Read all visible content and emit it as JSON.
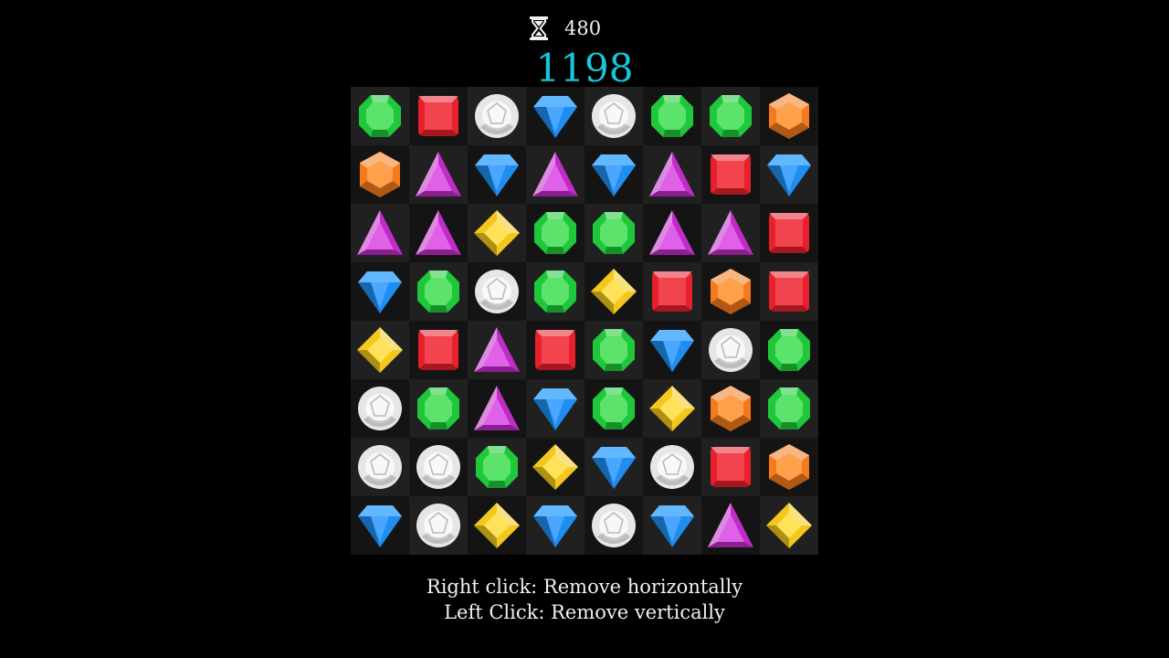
{
  "hud": {
    "timer_icon": "hourglass-icon",
    "time_remaining": "480",
    "score": "1198",
    "score_color": "#19c5d8"
  },
  "board": {
    "rows": 8,
    "cols": 8,
    "grid": [
      [
        "green",
        "red",
        "white",
        "blue",
        "white",
        "green",
        "green",
        "orange"
      ],
      [
        "orange",
        "purple",
        "blue",
        "purple",
        "blue",
        "purple",
        "red",
        "blue"
      ],
      [
        "purple",
        "purple",
        "yellow",
        "green",
        "green",
        "purple",
        "purple",
        "red"
      ],
      [
        "blue",
        "green",
        "white",
        "green",
        "yellow",
        "red",
        "orange",
        "red"
      ],
      [
        "yellow",
        "red",
        "purple",
        "red",
        "green",
        "blue",
        "white",
        "green"
      ],
      [
        "white",
        "green",
        "purple",
        "blue",
        "green",
        "yellow",
        "orange",
        "green"
      ],
      [
        "white",
        "white",
        "green",
        "yellow",
        "blue",
        "white",
        "red",
        "orange"
      ],
      [
        "blue",
        "white",
        "yellow",
        "blue",
        "white",
        "blue",
        "purple",
        "yellow"
      ]
    ],
    "gem_colors": {
      "green": "#1fc83a",
      "red": "#e8202c",
      "white": "#e6e6e6",
      "blue": "#1e8ef0",
      "orange": "#f47a1c",
      "purple": "#c02cc8",
      "yellow": "#f2c81c"
    }
  },
  "instructions": {
    "line1": "Right click: Remove horizontally",
    "line2": "Left Click: Remove vertically"
  }
}
